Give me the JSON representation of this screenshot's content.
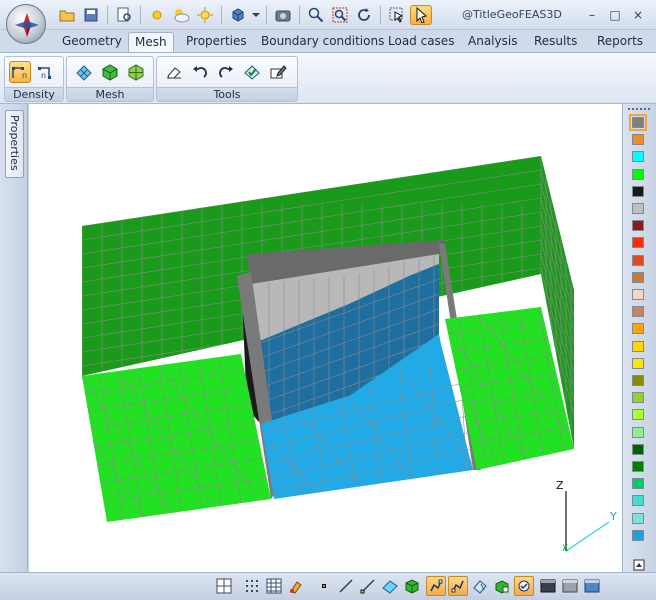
{
  "app": {
    "title": "@TitleGeoFEAS3D",
    "orb_icon": "compass-logo-icon"
  },
  "window_controls": {
    "minimize": "–",
    "restore": "□",
    "close": "×"
  },
  "quick_access": [
    {
      "id": "open",
      "icon": "folder-open-icon"
    },
    {
      "id": "save",
      "icon": "save-icon"
    },
    {
      "id": "print-preview",
      "icon": "print-preview-icon"
    },
    {
      "id": "light-1",
      "icon": "sun-light-icon"
    },
    {
      "id": "light-2",
      "icon": "cloud-sun-icon"
    },
    {
      "id": "light-3",
      "icon": "sun-rays-icon"
    },
    {
      "id": "view-cube",
      "icon": "cube-view-icon"
    },
    {
      "id": "screenshot",
      "icon": "camera-icon"
    },
    {
      "id": "zoom",
      "icon": "zoom-icon"
    },
    {
      "id": "zoom-window",
      "icon": "zoom-window-icon"
    },
    {
      "id": "rotate",
      "icon": "rotate-icon"
    },
    {
      "id": "select-box",
      "icon": "select-box-icon"
    },
    {
      "id": "pointer",
      "icon": "pointer-icon",
      "active": true
    }
  ],
  "tabs": [
    {
      "label": "Geometry"
    },
    {
      "label": "Mesh",
      "active": true
    },
    {
      "label": "Properties"
    },
    {
      "label": "Boundary conditions"
    },
    {
      "label": "Load cases"
    },
    {
      "label": "Analysis"
    },
    {
      "label": "Results"
    },
    {
      "label": "Reports"
    }
  ],
  "ribbon_groups": [
    {
      "label": "Density",
      "buttons": [
        "density-edge-icon",
        "density-node-icon"
      ]
    },
    {
      "label": "Mesh",
      "buttons": [
        "mesh-surface-icon",
        "mesh-solid-icon",
        "mesh-extrude-icon"
      ]
    },
    {
      "label": "Tools",
      "buttons": [
        "eraser-icon",
        "undo-icon",
        "redo-icon",
        "check-mesh-icon",
        "mesh-settings-icon"
      ]
    }
  ],
  "side_panel": {
    "properties_label": "Properties"
  },
  "axes": {
    "z": "Z",
    "y": "Y",
    "x": "X"
  },
  "palette": {
    "colors": [
      "#808080",
      "#f58a1f",
      "#00ffff",
      "#00ff00",
      "#1a1a1a",
      "#c0c0c0",
      "#8b1a1a",
      "#ff2a00",
      "#e04a20",
      "#c87a3a",
      "#f2d8c4",
      "#c8845a",
      "#ffa500",
      "#ffd700",
      "#ffe600",
      "#8b8b00",
      "#9acd32",
      "#adff2f",
      "#90ee90",
      "#006400",
      "#008000",
      "#00cc66",
      "#40e0d0",
      "#80e0e0",
      "#1ea0e0"
    ],
    "selected_index": 0
  },
  "bottom_toolbar": [
    {
      "icon": "single-view-icon"
    },
    {
      "icon": "grid-dots-icon"
    },
    {
      "icon": "table-icon"
    },
    {
      "icon": "paint-icon"
    },
    {
      "icon": "node-icon"
    },
    {
      "icon": "line-icon"
    },
    {
      "icon": "line-node-icon"
    },
    {
      "icon": "surface-icon"
    },
    {
      "icon": "solid-icon"
    },
    {
      "icon": "mesh-view-1-icon",
      "active": true
    },
    {
      "icon": "mesh-view-2-icon",
      "active": true
    },
    {
      "icon": "mesh-view-3-icon"
    },
    {
      "icon": "mesh-view-4-icon"
    },
    {
      "icon": "mesh-view-5-icon",
      "active": true
    },
    {
      "icon": "shade-dark-icon"
    },
    {
      "icon": "shade-mid-icon"
    },
    {
      "icon": "shade-light-icon"
    }
  ]
}
